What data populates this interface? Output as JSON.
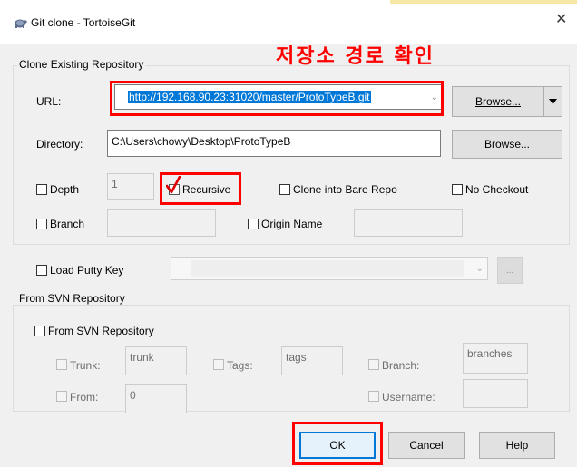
{
  "window": {
    "title": "Git clone - TortoiseGit",
    "close_glyph": "✕"
  },
  "annotation": {
    "text": "저장소 경로 확인"
  },
  "clone_group": {
    "label": "Clone Existing Repository",
    "url_label": "URL:",
    "url_value": "http://192.168.90.23:31020/master/ProtoTypeB.git",
    "browse_label": "Browse...",
    "directory_label": "Directory:",
    "directory_value": "C:\\Users\\chowy\\Desktop\\ProtoTypeB",
    "browse2_label": "Browse...",
    "depth_label": "Depth",
    "depth_value": "1",
    "recursive_label": "Recursive",
    "bare_label": "Clone into Bare Repo",
    "no_checkout_label": "No Checkout",
    "branch_label": "Branch",
    "origin_label": "Origin Name"
  },
  "putty": {
    "label": "Load Putty Key",
    "browse_label": "..."
  },
  "svn_group": {
    "label": "From SVN Repository",
    "from_svn_label": "From SVN Repository",
    "trunk_label": "Trunk:",
    "trunk_value": "trunk",
    "tags_label": "Tags:",
    "tags_value": "tags",
    "branch_label": "Branch:",
    "branch_value": "branches",
    "from_label": "From:",
    "from_value": "0",
    "username_label": "Username:"
  },
  "buttons": {
    "ok": "OK",
    "cancel": "Cancel",
    "help": "Help"
  },
  "colors": {
    "highlight": "#ff0000",
    "selection": "#0078d7",
    "check": "#e00000"
  }
}
